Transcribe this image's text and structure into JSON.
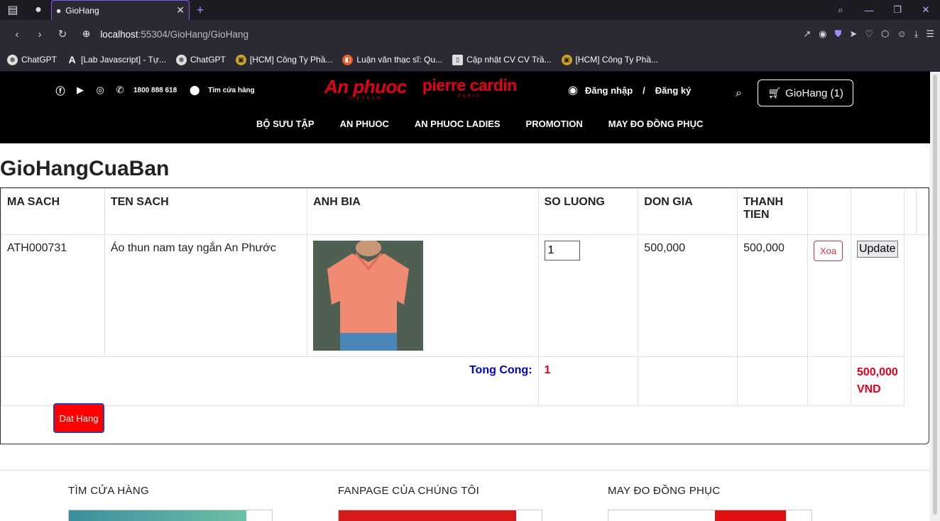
{
  "browser": {
    "tab_title": "GioHang",
    "url_host": "localhost",
    "url_path": ":55304/GioHang/GioHang",
    "bookmarks": [
      {
        "label": "ChatGPT",
        "icon": "openai-icon"
      },
      {
        "label": "[Lab Javascript] - Tự...",
        "icon": "a-icon"
      },
      {
        "label": "ChatGPT",
        "icon": "openai-icon"
      },
      {
        "label": "[HCM] Công Ty Phầ...",
        "icon": "box-icon"
      },
      {
        "label": "Luận văn thạc sĩ: Qu...",
        "icon": "book-icon"
      },
      {
        "label": "Cập nhật CV CV Trầ...",
        "icon": "doc-icon"
      },
      {
        "label": "[HCM] Công Ty Phầ...",
        "icon": "box-icon"
      }
    ]
  },
  "header": {
    "phone": "1800 888 618",
    "store_finder": "Tìm cửa hàng",
    "brand1": "An phuoc",
    "brand1_sub": "VIETNAM",
    "brand2": "pierre cardin",
    "brand2_sub": "PARIS",
    "login": "Đăng nhập",
    "separator": "/",
    "register": "Đăng ký",
    "cart": "GioHang (1)",
    "nav": [
      "BỘ SƯU TẬP",
      "AN PHUOC",
      "AN PHUOC LADIES",
      "PROMOTION",
      "MAY ĐO ĐỒNG PHỤC"
    ]
  },
  "cart": {
    "title": "GioHangCuaBan",
    "columns": [
      "MA SACH",
      "TEN SACH",
      "ANH BIA",
      "SO LUONG",
      "DON GIA",
      "THANH TIEN"
    ],
    "item": {
      "code": "ATH000731",
      "name": "Áo thun nam tay ngắn An Phước",
      "qty": "1",
      "price": "500,000",
      "total": "500,000",
      "delete_label": "Xoa",
      "update_label": "Update"
    },
    "summary_label": "Tong Cong:",
    "summary_qty": "1",
    "summary_total": "500,000 VND",
    "order_button": "Dat Hang"
  },
  "footer": {
    "col1": "TÌM CỬA HÀNG",
    "col2": "FANPAGE CỦA CHÚNG TÔI",
    "col3": "MAY ĐO ĐỒNG PHỤC"
  }
}
